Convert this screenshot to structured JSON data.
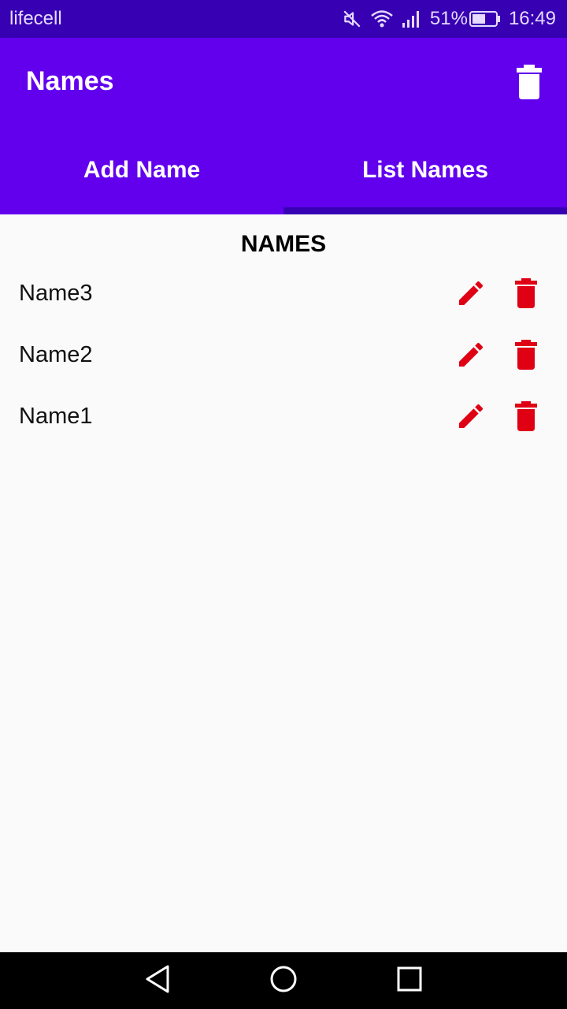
{
  "status_bar": {
    "carrier": "lifecell",
    "battery": "51%",
    "time": "16:49",
    "icons": [
      "mute-icon",
      "wifi-icon",
      "signal-icon",
      "battery-icon"
    ]
  },
  "app_bar": {
    "title": "Names",
    "action_icon": "delete-icon"
  },
  "tabs": [
    {
      "label": "Add Name",
      "active": false
    },
    {
      "label": "List Names",
      "active": true
    }
  ],
  "list": {
    "header": "NAMES",
    "items": [
      {
        "name": "Name3"
      },
      {
        "name": "Name2"
      },
      {
        "name": "Name1"
      }
    ],
    "row_icons": [
      "edit-icon",
      "delete-icon"
    ]
  },
  "nav_bar": {
    "icons": [
      "back-icon",
      "home-icon",
      "recents-icon"
    ]
  },
  "colors": {
    "status_bar": "#3700B3",
    "primary": "#6200EE",
    "tab_indicator": "#3700B3",
    "accent_red": "#E00014",
    "background": "#FAFAFA"
  }
}
